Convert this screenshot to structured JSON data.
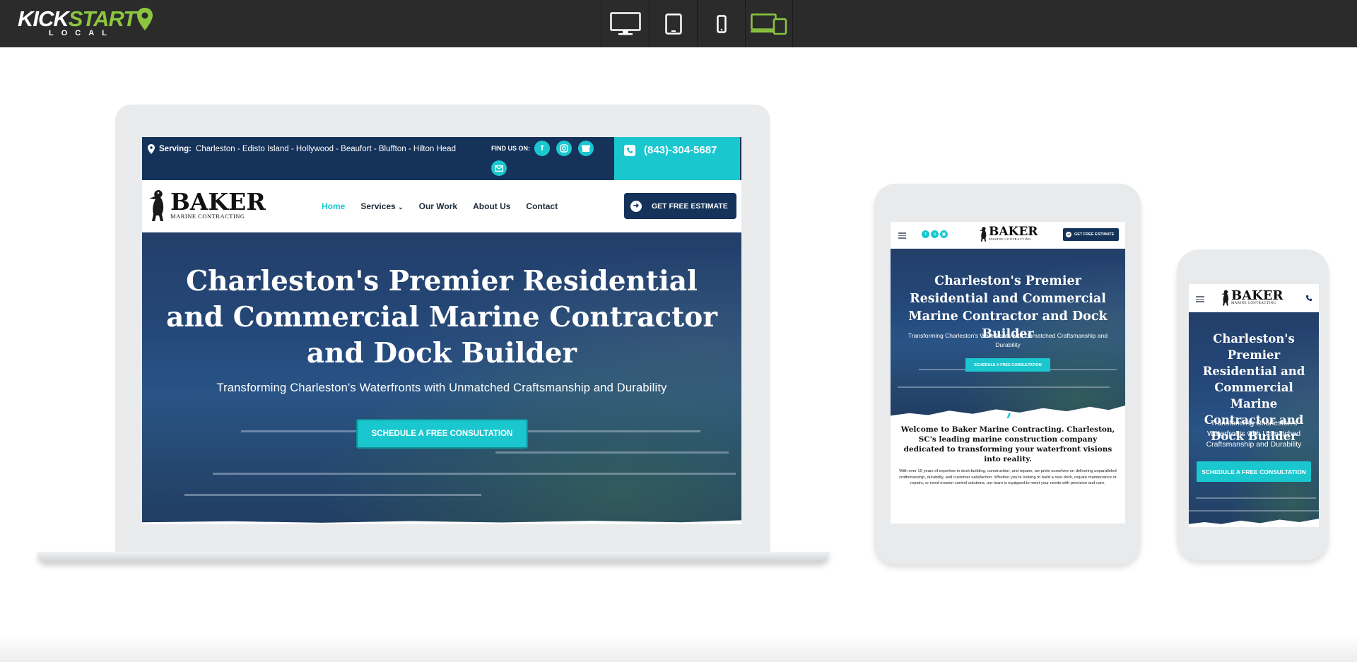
{
  "app": {
    "logo_word_left": "KICK",
    "logo_word_right": "START",
    "logo_sub": "LOCAL",
    "accent_color": "#8cc63f",
    "device_buttons": [
      {
        "name": "desktop-view",
        "icon": "monitor-icon",
        "active": false
      },
      {
        "name": "tablet-view",
        "icon": "tablet-icon",
        "active": false
      },
      {
        "name": "phone-view",
        "icon": "phone-icon",
        "active": false
      },
      {
        "name": "all-devices-view",
        "icon": "devices-icon",
        "active": true
      }
    ]
  },
  "site": {
    "brand_main": "BAKER",
    "brand_sub": "MARINE CONTRACTING",
    "serving_label": "Serving:",
    "serving_areas": "Charleston - Edisto Island - Hollywood - Beaufort - Bluffton - Hilton Head",
    "find_us": "FIND US ON:",
    "phone": "(843)-304-5687",
    "nav": {
      "home": "Home",
      "services": "Services",
      "our_work": "Our Work",
      "about": "About Us",
      "contact": "Contact"
    },
    "estimate_button": "GET FREE ESTIMATE",
    "hero_title": "Charleston's Premier Residential and Commercial Marine Contractor and Dock Builder",
    "hero_subtitle": "Transforming Charleston's Waterfronts with Unmatched Craftsmanship and Durability",
    "cta_button": "SCHEDULE A FREE CONSULTATION",
    "welcome_title": "Welcome to Baker Marine Contracting. Charleston, SC's leading marine construction company dedicated to transforming your waterfront visions into reality.",
    "welcome_body": "With over 10 years of expertise in dock building, construction, and repairs, we pride ourselves on delivering unparalleled craftsmanship, durability, and customer satisfaction. Whether you're looking to build a new dock, require maintenance or repairs, or need erosion control solutions, our team is equipped to meet your needs with precision and care.",
    "colors": {
      "navy": "#14325a",
      "teal": "#1ac7cf"
    }
  }
}
